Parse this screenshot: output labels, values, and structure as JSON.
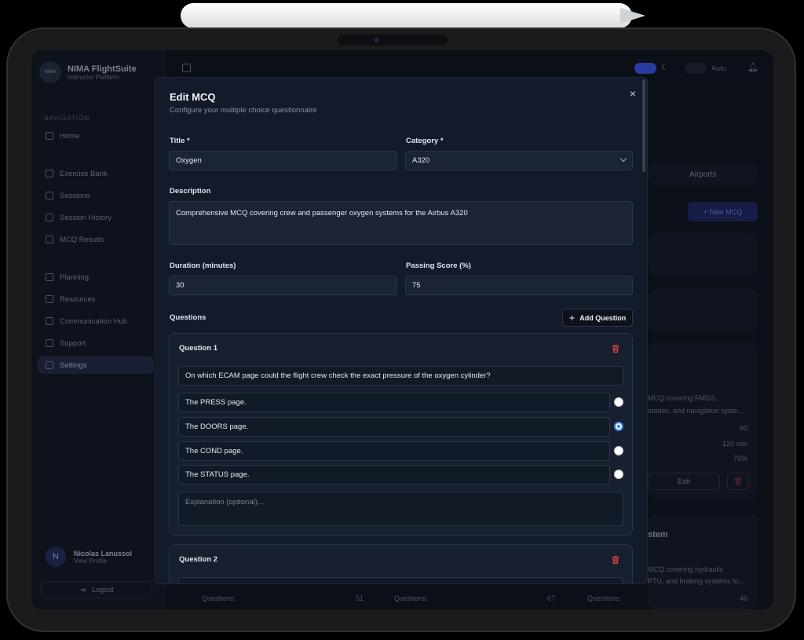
{
  "app": {
    "brand_name": "NIMA FlightSuite",
    "brand_sub": "Instructor Platform",
    "brand_logo": "NIMA",
    "nav_label": "NAVIGATION",
    "nav": [
      "Home",
      "Exercise Bank",
      "Sessions",
      "Session History",
      "MCQ Results",
      "Planning",
      "Resources",
      "Communication Hub",
      "Support",
      "Settings"
    ],
    "user_initial": "N",
    "user_name": "Nicolas Lanussol",
    "user_sub": "View Profile",
    "logout": "Logout",
    "theme_auto": "Auto",
    "tab_airports": "Airports",
    "new_mcq": "+ New MCQ",
    "bg_card_desc_1": "MCQ covering FMGS,",
    "bg_card_desc_2": "modes, and navigation syste...",
    "bg_val_1": "60",
    "bg_val_2": "120 min",
    "bg_val_3": "75%",
    "bg_edit": "Edit",
    "bg_card2_title": "stem",
    "bg_card2_desc_1": "MCQ covering hydraulic",
    "bg_card2_desc_2": "PTU, and braking systems fo...",
    "questions_label": "Questions:",
    "q_counts": [
      "51",
      "67",
      "46"
    ]
  },
  "modal": {
    "title": "Edit MCQ",
    "subtitle": "Configure your multiple choice questionnaire",
    "close": "×",
    "title_label": "Title *",
    "title_value": "Oxygen",
    "category_label": "Category *",
    "category_value": "A320",
    "description_label": "Description",
    "description_value": "Comprehensive MCQ covering crew and passenger oxygen systems for the Airbus A320",
    "duration_label": "Duration (minutes)",
    "duration_value": "30",
    "passing_label": "Passing Score (%)",
    "passing_value": "75",
    "questions_label": "Questions",
    "add_question": "Add Question",
    "questions": [
      {
        "title": "Question 1",
        "text": "On which ECAM page could the flight crew check the exact pressure of the oxygen cylinder?",
        "options": [
          "The PRESS page.",
          "The DOORS page.",
          "The COND page.",
          "The STATUS page."
        ],
        "correct_index": 1,
        "explanation_placeholder": "Explanation (optional)..."
      },
      {
        "title": "Question 2"
      }
    ]
  },
  "colors": {
    "accent": "#3b82f6",
    "danger": "#ef4444",
    "modal_bg": "#131a2a"
  }
}
